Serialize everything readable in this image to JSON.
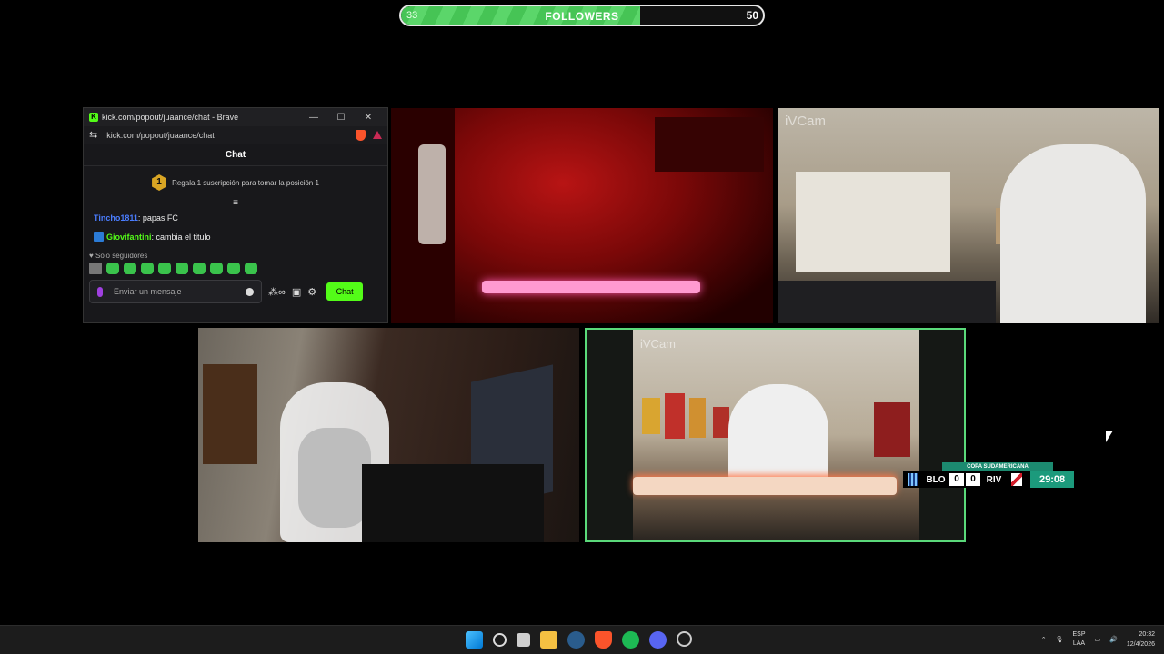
{
  "followers_goal": {
    "current": "33",
    "label": "FOLLOWERS",
    "goal": "50",
    "progress": 0.66
  },
  "chat_window": {
    "title": "kick.com/popout/juaance/chat - Brave",
    "url": "kick.com/popout/juaance/chat",
    "header": "Chat",
    "promo_rank": "1",
    "promo_text": "Regala 1 suscripción para tomar la posición 1",
    "messages": [
      {
        "user": "Tincho1811",
        "text": ": papas FC"
      },
      {
        "user": "Giovifantini",
        "text": ": cambia el titulo"
      }
    ],
    "followers_only": "Solo seguidores",
    "input_placeholder": "Enviar un mensaje",
    "send_label": "Chat",
    "icons": [
      "kick-logo",
      "minimize-icon",
      "maximize-icon",
      "close-icon",
      "brave-shield-icon",
      "mic-icon",
      "emoji-icon",
      "infinity-icon",
      "store-icon",
      "settings-icon"
    ]
  },
  "cameras": {
    "top_right_label": "iVCam",
    "bottom_right_label": "iVCam"
  },
  "scoreboard": {
    "competition": "COPA SUDAMERICANA",
    "home": "BLO",
    "home_score": "0",
    "away_score": "0",
    "away": "RIV",
    "clock": "29:08"
  },
  "taskbar": {
    "lang_top": "ESP",
    "lang_bottom": "LAA",
    "time": "20:32",
    "date": "12/4/2026",
    "apps": [
      "windows-start",
      "search",
      "task-view",
      "file-explorer",
      "steam",
      "brave",
      "spotify",
      "discord",
      "other-app"
    ]
  },
  "colors": {
    "kick_green": "#53fc18",
    "progress_green": "#46c455",
    "score_teal": "#1c9a7c"
  }
}
